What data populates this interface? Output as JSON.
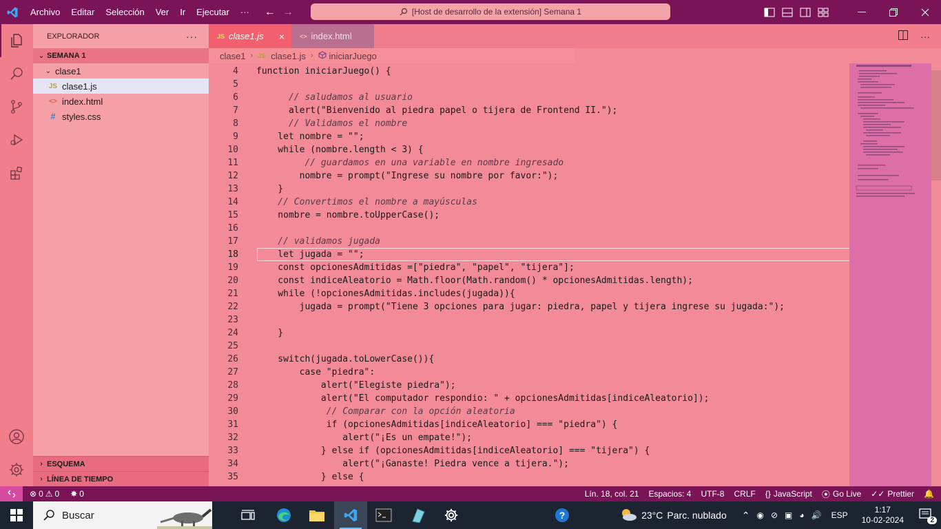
{
  "titlebar": {
    "menu": [
      "Archivo",
      "Editar",
      "Selección",
      "Ver",
      "Ir",
      "Ejecutar"
    ],
    "more": "···",
    "command_center": "[Host de desarrollo de la extensión] Semana 1"
  },
  "sidebar": {
    "title": "EXPLORADOR",
    "more": "···",
    "workspace": "SEMANA 1",
    "folder": "clase1",
    "files": [
      {
        "name": "clase1.js",
        "icon": "JS",
        "selected": true
      },
      {
        "name": "index.html",
        "icon": "<>",
        "selected": false
      },
      {
        "name": "styles.css",
        "icon": "#",
        "selected": false
      }
    ],
    "outline": "ESQUEMA",
    "timeline": "LÍNEA DE TIEMPO"
  },
  "tabs": [
    {
      "label": "clase1.js",
      "icon": "JS",
      "active": true
    },
    {
      "label": "index.html",
      "icon": "<>",
      "active": false
    }
  ],
  "breadcrumbs": {
    "folder": "clase1",
    "file": "clase1.js",
    "symbol": "iniciarJuego"
  },
  "code": {
    "current_line": 18,
    "lines": [
      {
        "n": "4",
        "text": "function iniciarJuego() {"
      },
      {
        "n": "5",
        "text": ""
      },
      {
        "n": "6",
        "text": "      // saludamos al usuario",
        "comment": true
      },
      {
        "n": "7",
        "text": "      alert(\"Bienvenido al piedra papel o tijera de Frontend II.\");"
      },
      {
        "n": "8",
        "text": "      // Validamos el nombre",
        "comment": true
      },
      {
        "n": "9",
        "text": "    let nombre = \"\";"
      },
      {
        "n": "10",
        "text": "    while (nombre.length < 3) {"
      },
      {
        "n": "11",
        "text": "         // guardamos en una variable en nombre ingresado",
        "comment": true
      },
      {
        "n": "12",
        "text": "        nombre = prompt(\"Ingrese su nombre por favor:\");"
      },
      {
        "n": "13",
        "text": "    }"
      },
      {
        "n": "14",
        "text": "    // Convertimos el nombre a mayúsculas",
        "comment": true
      },
      {
        "n": "15",
        "text": "    nombre = nombre.toUpperCase();"
      },
      {
        "n": "16",
        "text": ""
      },
      {
        "n": "17",
        "text": "    // validamos jugada",
        "comment": true
      },
      {
        "n": "18",
        "text": "    let jugada = \"\";"
      },
      {
        "n": "19",
        "text": "    const opcionesAdmitidas =[\"piedra\", \"papel\", \"tijera\"];"
      },
      {
        "n": "20",
        "text": "    const indiceAleatorio = Math.floor(Math.random() * opcionesAdmitidas.length);"
      },
      {
        "n": "21",
        "text": "    while (!opcionesAdmitidas.includes(jugada)){"
      },
      {
        "n": "22",
        "text": "        jugada = prompt(\"Tiene 3 opciones para jugar: piedra, papel y tijera ingrese su jugada:\");"
      },
      {
        "n": "23",
        "text": ""
      },
      {
        "n": "24",
        "text": "    }"
      },
      {
        "n": "25",
        "text": ""
      },
      {
        "n": "26",
        "text": "    switch(jugada.toLowerCase()){"
      },
      {
        "n": "27",
        "text": "        case \"piedra\":"
      },
      {
        "n": "28",
        "text": "            alert(\"Elegiste piedra\");"
      },
      {
        "n": "29",
        "text": "            alert(\"El computador respondio: \" + opcionesAdmitidas[indiceAleatorio]);"
      },
      {
        "n": "30",
        "text": "             // Comparar con la opción aleatoria",
        "comment": true
      },
      {
        "n": "31",
        "text": "             if (opcionesAdmitidas[indiceAleatorio] === \"piedra\") {"
      },
      {
        "n": "32",
        "text": "                alert(\"¡Es un empate!\");"
      },
      {
        "n": "33",
        "text": "            } else if (opcionesAdmitidas[indiceAleatorio] === \"tijera\") {"
      },
      {
        "n": "34",
        "text": "                alert(\"¡Ganaste! Piedra vence a tijera.\");"
      },
      {
        "n": "35",
        "text": "            } else {"
      }
    ]
  },
  "statusbar": {
    "errors": "0",
    "warnings": "0",
    "ports": "0",
    "position": "Lín. 18, col. 21",
    "spaces": "Espacios: 4",
    "encoding": "UTF-8",
    "eol": "CRLF",
    "language": "JavaScript",
    "golive": "Go Live",
    "prettier": "Prettier"
  },
  "taskbar": {
    "search_placeholder": "Buscar",
    "weather_temp": "23°C",
    "weather_desc": "Parc. nublado",
    "lang": "ESP",
    "time": "1:17",
    "date": "10-02-2024",
    "notifications": "2"
  },
  "colors": {
    "titlebar": "#7a1457",
    "activitybar": "#f27e8b",
    "sidebar": "#f4a0a6",
    "editor": "#f28a98",
    "minimap": "#dd6fa6",
    "statusbar": "#7a1457"
  }
}
